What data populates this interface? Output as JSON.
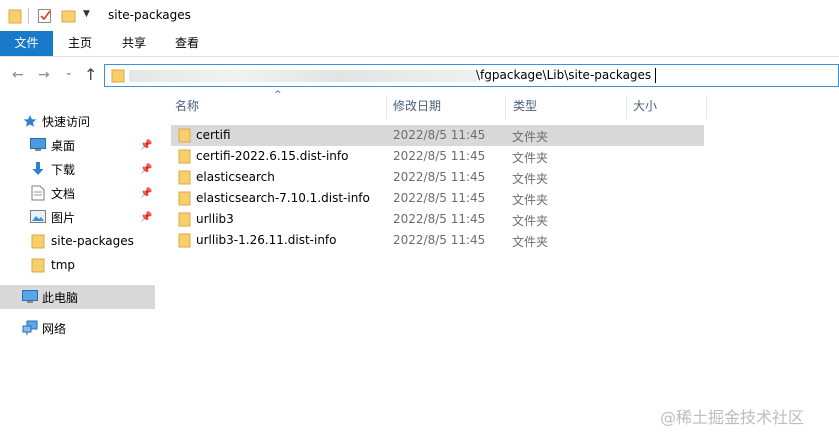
{
  "window": {
    "title": "site-packages"
  },
  "ribbon": {
    "tabs": [
      {
        "label": "文件"
      },
      {
        "label": "主页"
      },
      {
        "label": "共享"
      },
      {
        "label": "查看"
      }
    ]
  },
  "address": {
    "path_visible": "\\fgpackage\\Lib\\site-packages"
  },
  "sidebar": {
    "quick_access": "快速访问",
    "pinned": [
      {
        "label": "桌面",
        "icon": "desktop-icon"
      },
      {
        "label": "下载",
        "icon": "download-icon"
      },
      {
        "label": "文档",
        "icon": "document-icon"
      },
      {
        "label": "图片",
        "icon": "pictures-icon"
      }
    ],
    "recent": [
      {
        "label": "site-packages",
        "icon": "folder-icon"
      },
      {
        "label": "tmp",
        "icon": "folder-icon"
      }
    ],
    "this_pc": "此电脑",
    "network": "网络"
  },
  "columns": {
    "name": "名称",
    "modified": "修改日期",
    "type": "类型",
    "size": "大小"
  },
  "files": [
    {
      "name": "certifi",
      "modified": "2022/8/5 11:45",
      "type": "文件夹"
    },
    {
      "name": "certifi-2022.6.15.dist-info",
      "modified": "2022/8/5 11:45",
      "type": "文件夹"
    },
    {
      "name": "elasticsearch",
      "modified": "2022/8/5 11:45",
      "type": "文件夹"
    },
    {
      "name": "elasticsearch-7.10.1.dist-info",
      "modified": "2022/8/5 11:45",
      "type": "文件夹"
    },
    {
      "name": "urllib3",
      "modified": "2022/8/5 11:45",
      "type": "文件夹"
    },
    {
      "name": "urllib3-1.26.11.dist-info",
      "modified": "2022/8/5 11:45",
      "type": "文件夹"
    }
  ],
  "watermark": "@稀土掘金技术社区",
  "colors": {
    "file_tab": "#1979ca",
    "folder": "#f9cf6c",
    "selection": "#d9d9d9",
    "address_border": "#3c8fd8"
  }
}
